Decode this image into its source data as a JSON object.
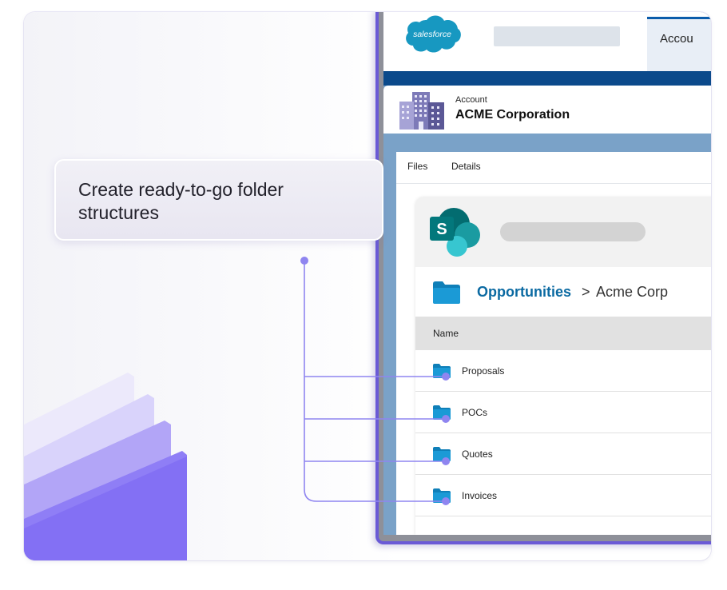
{
  "callout": {
    "text": "Create ready-to-go folder structures"
  },
  "salesforce": {
    "logo_text": "salesforce",
    "tab_label": "Accou"
  },
  "account": {
    "label": "Account",
    "name": "ACME Corporation"
  },
  "tabs": [
    {
      "label": "Files"
    },
    {
      "label": "Details"
    }
  ],
  "sharepoint": {
    "logo_letter": "S",
    "breadcrumb": {
      "parent": "Opportunities",
      "separator": ">",
      "current": "Acme Corp"
    },
    "column_header": "Name",
    "folders": [
      {
        "label": "Proposals"
      },
      {
        "label": "POCs"
      },
      {
        "label": "Quotes"
      },
      {
        "label": "Invoices"
      }
    ]
  },
  "colors": {
    "accent": "#8f85f0",
    "salesforce_blue": "#1798c1",
    "folder_blue": "#1b9ad6",
    "breadcrumb_link": "#0b6aa2",
    "sharepoint_teal": "#038387"
  },
  "icons": [
    "salesforce-logo",
    "building-icon",
    "sharepoint-logo",
    "folder-icon"
  ]
}
